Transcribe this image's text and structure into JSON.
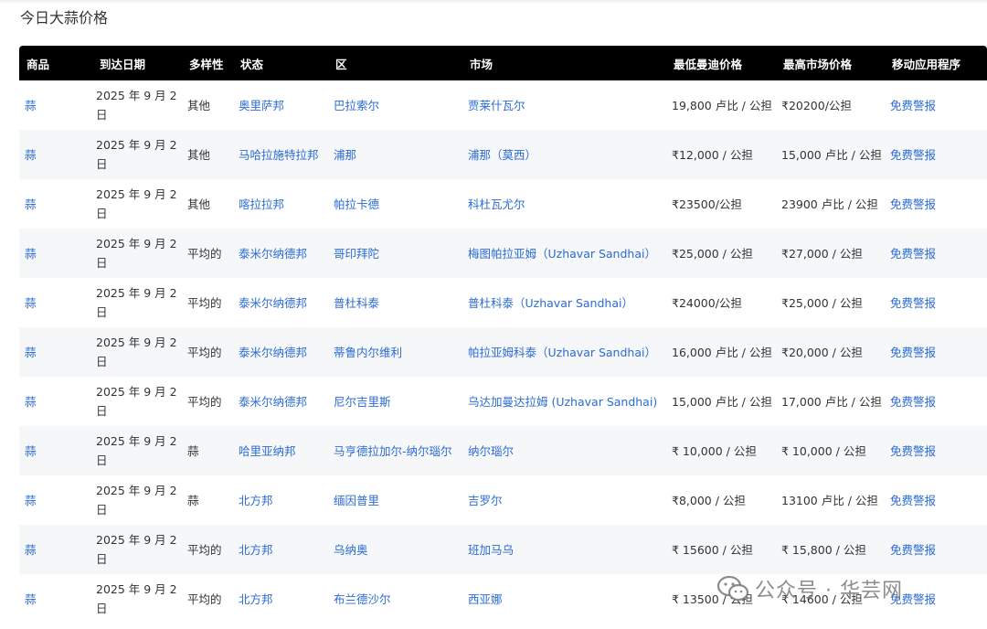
{
  "page": {
    "title": "今日大蒜价格"
  },
  "table": {
    "headers": [
      "商品",
      "到达日期",
      "多样性",
      "状态",
      "区",
      "市场",
      "最低曼迪价格",
      "最高市场价格",
      "移动应用程序"
    ],
    "rows": [
      [
        "蒜",
        "2025 年 9 月 2 日",
        "其他",
        "奥里萨邦",
        "巴拉索尔",
        "贾莱什瓦尔",
        "19,800 卢比 / 公担",
        "₹20200/公担",
        "免费警报"
      ],
      [
        "蒜",
        "2025 年 9 月 2 日",
        "其他",
        "马哈拉施特拉邦",
        "浦那",
        "浦那（莫西）",
        "₹12,000 / 公担",
        "15,000 卢比 / 公担",
        "免费警报"
      ],
      [
        "蒜",
        "2025 年 9 月 2 日",
        "其他",
        "喀拉拉邦",
        "帕拉卡德",
        "科杜瓦尤尔",
        "₹23500/公担",
        "23900 卢比 / 公担",
        "免费警报"
      ],
      [
        "蒜",
        "2025 年 9 月 2 日",
        "平均的",
        "泰米尔纳德邦",
        "哥印拜陀",
        "梅图帕拉亚姆（Uzhavar Sandhai）",
        "₹25,000 / 公担",
        "₹27,000 / 公担",
        "免费警报"
      ],
      [
        "蒜",
        "2025 年 9 月 2 日",
        "平均的",
        "泰米尔纳德邦",
        "普杜科泰",
        "普杜科泰（Uzhavar Sandhai）",
        "₹24000/公担",
        "₹25,000 / 公担",
        "免费警报"
      ],
      [
        "蒜",
        "2025 年 9 月 2 日",
        "平均的",
        "泰米尔纳德邦",
        "蒂鲁内尔维利",
        "帕拉亚姆科泰（Uzhavar Sandhai）",
        "16,000 卢比 / 公担",
        "₹20,000 / 公担",
        "免费警报"
      ],
      [
        "蒜",
        "2025 年 9 月 2 日",
        "平均的",
        "泰米尔纳德邦",
        "尼尔吉里斯",
        "乌达加曼达拉姆 (Uzhavar Sandhai)",
        "15,000 卢比 / 公担",
        "17,000 卢比 / 公担",
        "免费警报"
      ],
      [
        "蒜",
        "2025 年 9 月 2 日",
        "蒜",
        "哈里亚纳邦",
        "马亨德拉加尔-纳尔瑙尔",
        "纳尔瑙尔",
        "₹ 10,000 / 公担",
        "₹ 10,000 / 公担",
        "免费警报"
      ],
      [
        "蒜",
        "2025 年 9 月 2 日",
        "蒜",
        "北方邦",
        "缅因普里",
        "吉罗尔",
        "₹8,000 / 公担",
        "13100 卢比 / 公担",
        "免费警报"
      ],
      [
        "蒜",
        "2025 年 9 月 2 日",
        "平均的",
        "北方邦",
        "乌纳奥",
        "班加马乌",
        "₹ 15600 / 公担",
        "₹ 15,800 / 公担",
        "免费警报"
      ],
      [
        "蒜",
        "2025 年 9 月 2 日",
        "平均的",
        "北方邦",
        "布兰德沙尔",
        "西亚娜",
        "₹ 13500 / 公担",
        "₹ 14600 / 公担",
        "免费警报"
      ]
    ]
  },
  "watermark": {
    "text": "公众号 · 华芸网",
    "icon": "wechat-icon"
  },
  "colors": {
    "link": "#2b6bd3",
    "header_bg": "#000000",
    "stripe": "#f6f7f9"
  }
}
